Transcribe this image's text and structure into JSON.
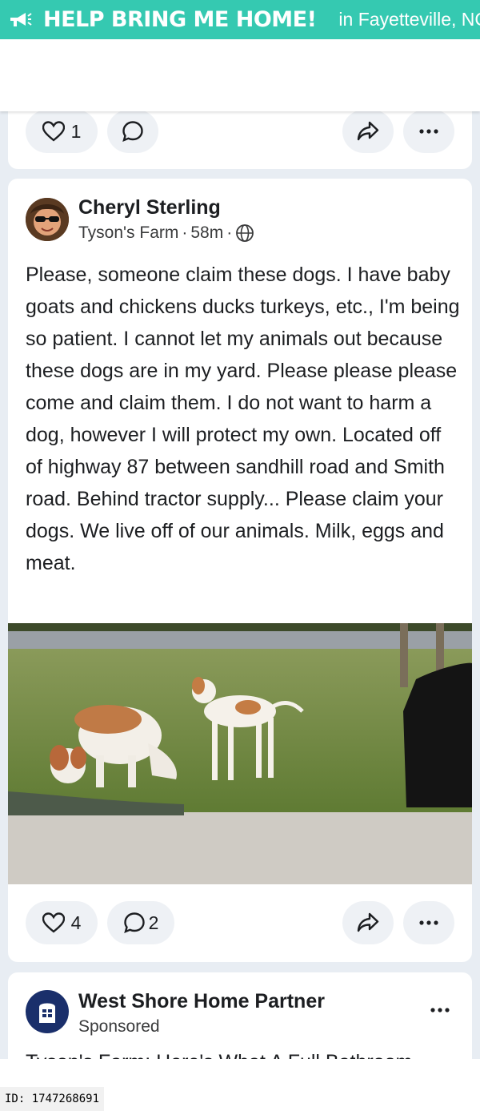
{
  "banner": {
    "headline": "HELP BRING ME HOME!",
    "location": "in Fayetteville, NC",
    "icon": "megaphone-icon",
    "bg_color": "#35c9b1"
  },
  "prev_post": {
    "likes": "1"
  },
  "post": {
    "author": "Cheryl Sterling",
    "group": "Tyson's Farm",
    "time": "58m",
    "privacy_icon": "globe-icon",
    "text": "Please, someone claim these dogs.  I have baby goats and chickens ducks turkeys, etc., I'm being so patient. I cannot let my animals out because these dogs are in my yard.  Please please please come and claim them. I do not want to harm a dog, however I will protect my own.   Located off of highway 87 between sandhill road and Smith road.  Behind tractor supply... Please claim your dogs.  We live off of our animals.  Milk, eggs and meat.",
    "likes": "4",
    "comments": "2"
  },
  "ad": {
    "advertiser": "West Shore Home Partner",
    "label": "Sponsored",
    "text": "Tyson's Farm: Here's What A Full Bathroom"
  },
  "footer": {
    "id_text": "ID: 1747268691"
  }
}
